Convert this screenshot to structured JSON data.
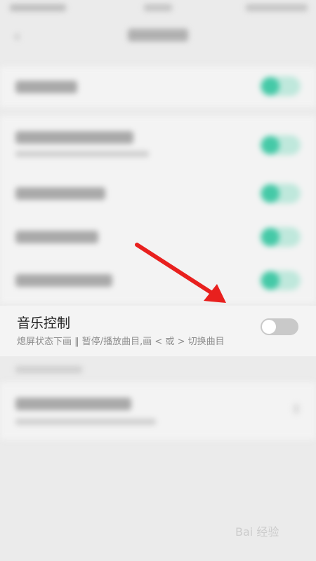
{
  "header": {
    "back_icon": "back-arrow-icon"
  },
  "music_control": {
    "title": "音乐控制",
    "subtitle": "熄屏状态下画 ‖ 暂停/播放曲目,画 < 或 > 切换曲目",
    "enabled": false
  },
  "watermark": {
    "text": "Bai 经验"
  },
  "colors": {
    "toggle_on": "#45c9a7",
    "toggle_off": "#c9c9c9",
    "arrow": "#e8201e",
    "page_bg": "#ebebeb"
  }
}
